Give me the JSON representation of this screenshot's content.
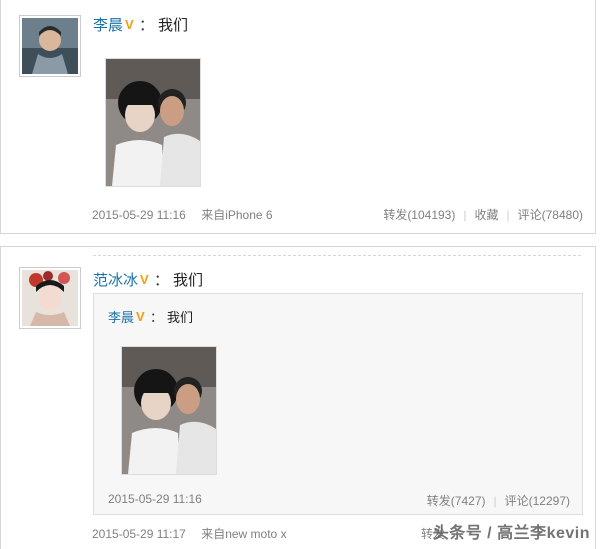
{
  "post1": {
    "author": "李晨",
    "text": "我们",
    "time": "2015-05-29 11:16",
    "source": "来自iPhone 6",
    "repost": "转发(104193)",
    "favorite": "收藏",
    "comment": "评论(78480)"
  },
  "post2": {
    "author": "范冰冰",
    "text": "我们",
    "time": "2015-05-29 11:17",
    "source": "来自new moto x",
    "repost_partial": "转发",
    "repost_label": "转发",
    "quoted": {
      "author": "李晨",
      "text": "我们",
      "time": "2015-05-29 11:16",
      "repost": "转发(7427)",
      "comment": "评论(12297)"
    }
  },
  "watermark": "头条号 / 高兰李kevin",
  "colors": {
    "link": "#1a73a8",
    "verified": "#f39c12",
    "meta": "#808080"
  }
}
